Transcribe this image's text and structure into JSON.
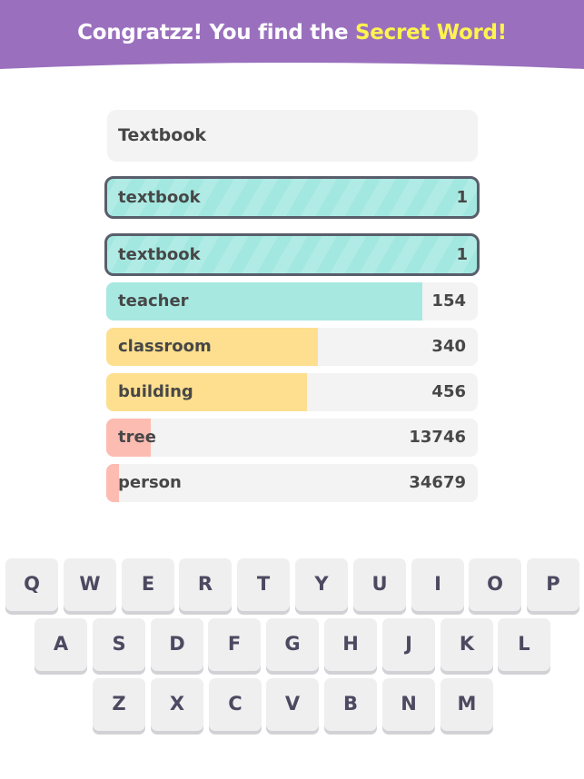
{
  "header": {
    "title_prefix": "Congratzz! You find the ",
    "title_highlight": "Secret Word!",
    "bg_color": "#9a70be",
    "highlight_color": "#fff34f"
  },
  "input": {
    "value": "Textbook"
  },
  "guesses": [
    {
      "word": "textbook",
      "rank": "1",
      "type": "hit",
      "fill_fraction": 1.0,
      "color": "#a7e9e1"
    },
    {
      "word": "textbook",
      "rank": "1",
      "type": "hit",
      "fill_fraction": 1.0,
      "color": "#a7e9e1"
    },
    {
      "word": "teacher",
      "rank": "154",
      "type": "close",
      "fill_fraction": 0.85,
      "color": "#a7e9e1"
    },
    {
      "word": "classroom",
      "rank": "340",
      "type": "medium",
      "fill_fraction": 0.57,
      "color": "#fddf8f"
    },
    {
      "word": "building",
      "rank": "456",
      "type": "medium",
      "fill_fraction": 0.54,
      "color": "#fddf8f"
    },
    {
      "word": "tree",
      "rank": "13746",
      "type": "far",
      "fill_fraction": 0.12,
      "color": "#fdbcb2"
    },
    {
      "word": "person",
      "rank": "34679",
      "type": "far",
      "fill_fraction": 0.035,
      "color": "#fdbcb2"
    }
  ],
  "keyboard": {
    "rows": [
      [
        "Q",
        "W",
        "E",
        "R",
        "T",
        "Y",
        "U",
        "I",
        "O",
        "P"
      ],
      [
        "A",
        "S",
        "D",
        "F",
        "G",
        "H",
        "J",
        "K",
        "L"
      ],
      [
        "Z",
        "X",
        "C",
        "V",
        "B",
        "N",
        "M"
      ]
    ]
  }
}
